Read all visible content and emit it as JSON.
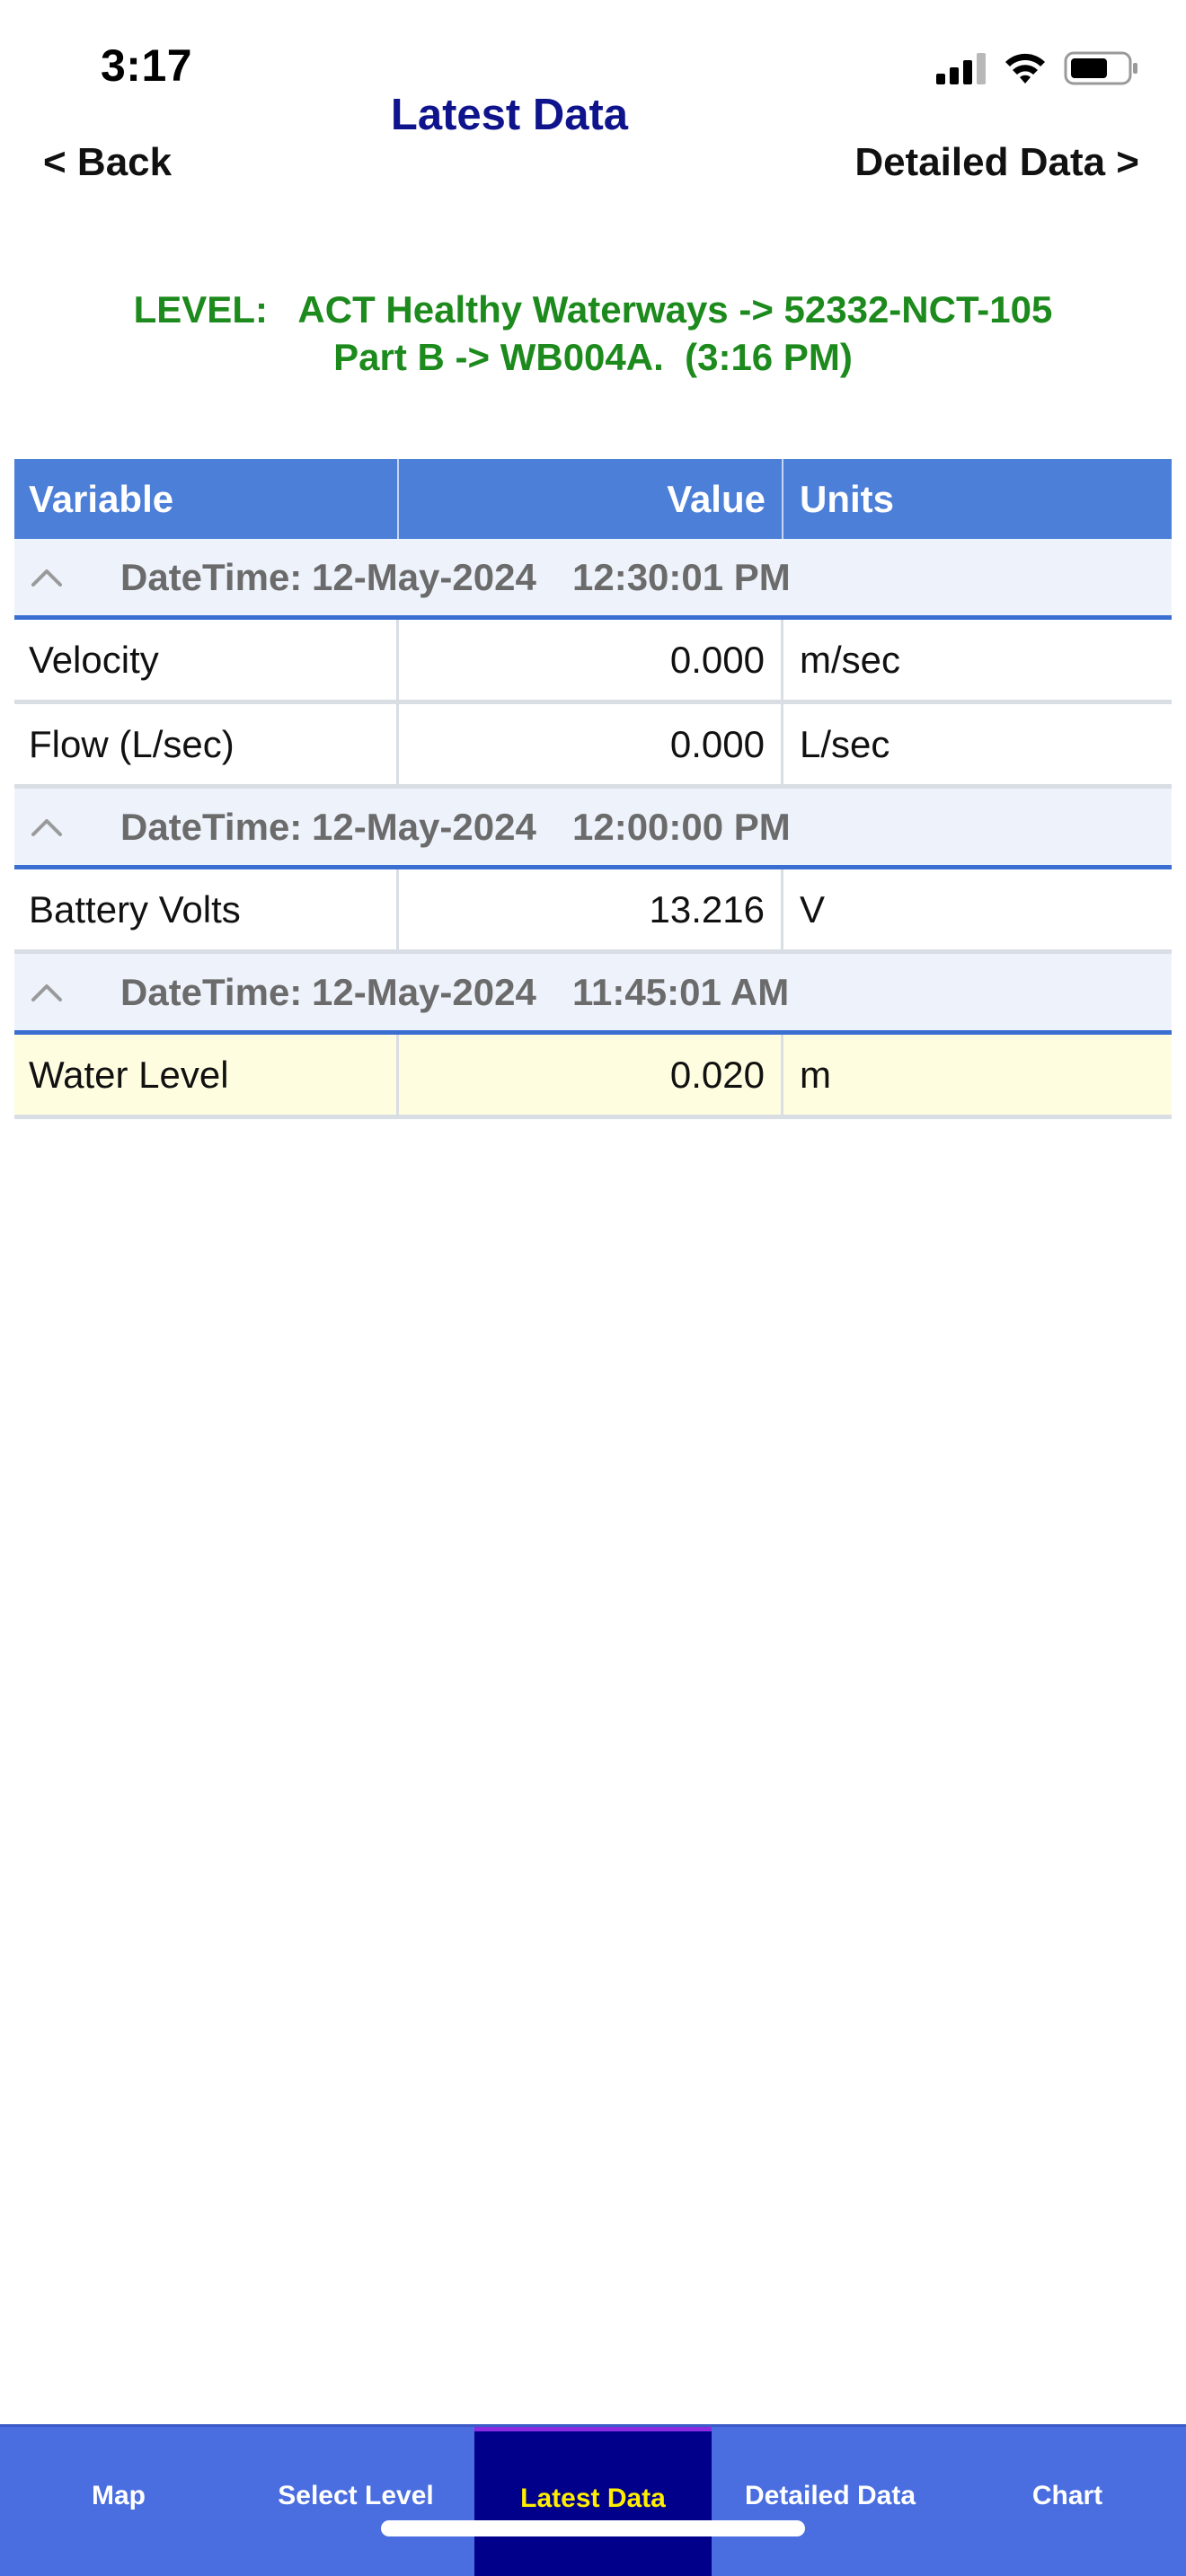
{
  "status_bar": {
    "time": "3:17"
  },
  "nav": {
    "title": "Latest Data",
    "back_label": "< Back",
    "detail_label": "Detailed Data >"
  },
  "level": {
    "line1": "LEVEL:   ACT Healthy Waterways -> 52332-NCT-105",
    "line2": "Part B -> WB004A.  (3:16 PM)"
  },
  "table": {
    "headers": [
      "Variable",
      "Value",
      "Units"
    ],
    "groups": [
      {
        "label": "DateTime:",
        "date": "12-May-2024",
        "time": "12:30:01 PM",
        "rows": [
          {
            "variable": "Velocity",
            "value": "0.000",
            "units": "m/sec"
          },
          {
            "variable": "Flow (L/sec)",
            "value": "0.000",
            "units": "L/sec"
          }
        ]
      },
      {
        "label": "DateTime:",
        "date": "12-May-2024",
        "time": "12:00:00 PM",
        "rows": [
          {
            "variable": "Battery Volts",
            "value": "13.216",
            "units": "V"
          }
        ]
      },
      {
        "label": "DateTime:",
        "date": "12-May-2024",
        "time": "11:45:01 AM",
        "rows": [
          {
            "variable": "Water Level",
            "value": "0.020",
            "units": "m"
          }
        ]
      }
    ]
  },
  "tabs": [
    {
      "label": "Map",
      "active": false
    },
    {
      "label": "Select Level",
      "active": false
    },
    {
      "label": "Latest Data",
      "active": true
    },
    {
      "label": "Detailed Data",
      "active": false
    },
    {
      "label": "Chart",
      "active": false
    }
  ],
  "colors": {
    "header_blue": "#4c7fd8",
    "title_navy": "#0f148c",
    "level_green": "#1c8a1c",
    "tab_bar": "#4a6de0",
    "tab_active_bg": "#00008b",
    "tab_active_text": "#ffee00",
    "highlight_row": "#fffde0"
  }
}
